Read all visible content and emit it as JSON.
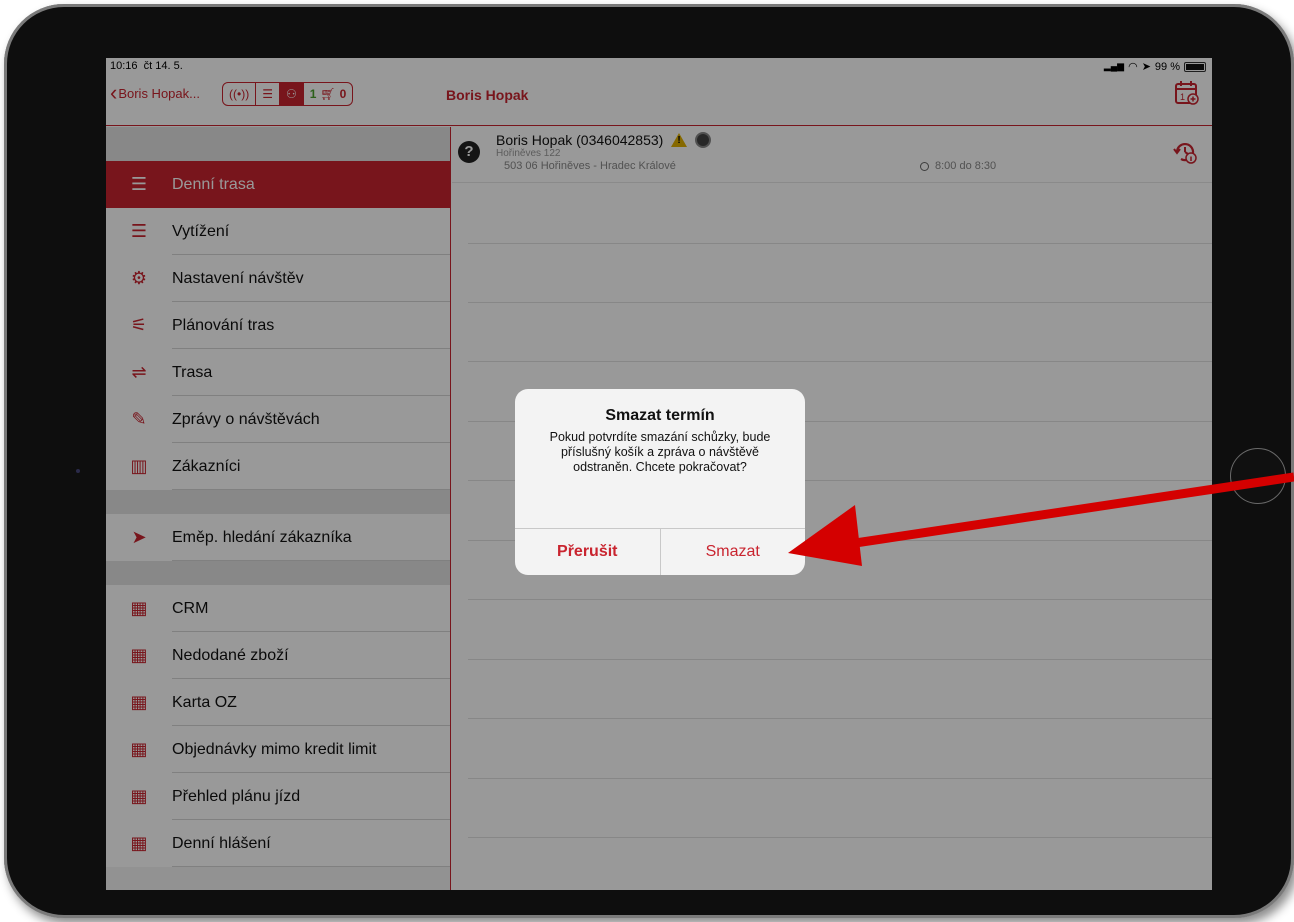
{
  "status_bar": {
    "time": "10:16",
    "date": "čt 14. 5.",
    "battery": "99 %"
  },
  "nav": {
    "back_label": "Boris Hopak...",
    "title": "Boris Hopak",
    "cart_left_count": "1",
    "cart_right_count": "0"
  },
  "sidebar": {
    "group1": [
      {
        "label": "Denní trasa",
        "icon": "list-icon",
        "active": true
      },
      {
        "label": "Vytížení",
        "icon": "list-icon"
      },
      {
        "label": "Nastavení návštěv",
        "icon": "gear-nodes-icon"
      },
      {
        "label": "Plánování tras",
        "icon": "signpost-gear-icon"
      },
      {
        "label": "Trasa",
        "icon": "signpost-icon"
      },
      {
        "label": "Zprávy o návštěvách",
        "icon": "note-edit-icon"
      },
      {
        "label": "Zákazníci",
        "icon": "buildings-icon"
      }
    ],
    "group2": [
      {
        "label": "Eměp. hledání zákazníka",
        "icon": "location-arrow-icon"
      }
    ],
    "group3": [
      {
        "label": "CRM",
        "icon": "monitor-icon"
      },
      {
        "label": "Nedodané zboží",
        "icon": "monitor-icon"
      },
      {
        "label": "Karta OZ",
        "icon": "monitor-icon"
      },
      {
        "label": "Objednávky mimo kredit limit",
        "icon": "monitor-icon"
      },
      {
        "label": "Přehled plánu jízd",
        "icon": "monitor-icon"
      },
      {
        "label": "Denní hlášení",
        "icon": "monitor-icon"
      }
    ]
  },
  "visit": {
    "name": "Boris Hopak (0346042853)",
    "street": "Hořiněves 122",
    "city": "503 06 Hořiněves - Hradec Králové",
    "time": "8:00 do 8:30"
  },
  "alert": {
    "title": "Smazat termín",
    "message": "Pokud potvrdíte smazání schůzky, bude příslušný košík a zpráva o návštěvě odstraněn. Chcete pokračovat?",
    "cancel_label": "Přerušit",
    "delete_label": "Smazat"
  },
  "colors": {
    "accent": "#c9242f",
    "annotation_arrow": "#d40000"
  }
}
